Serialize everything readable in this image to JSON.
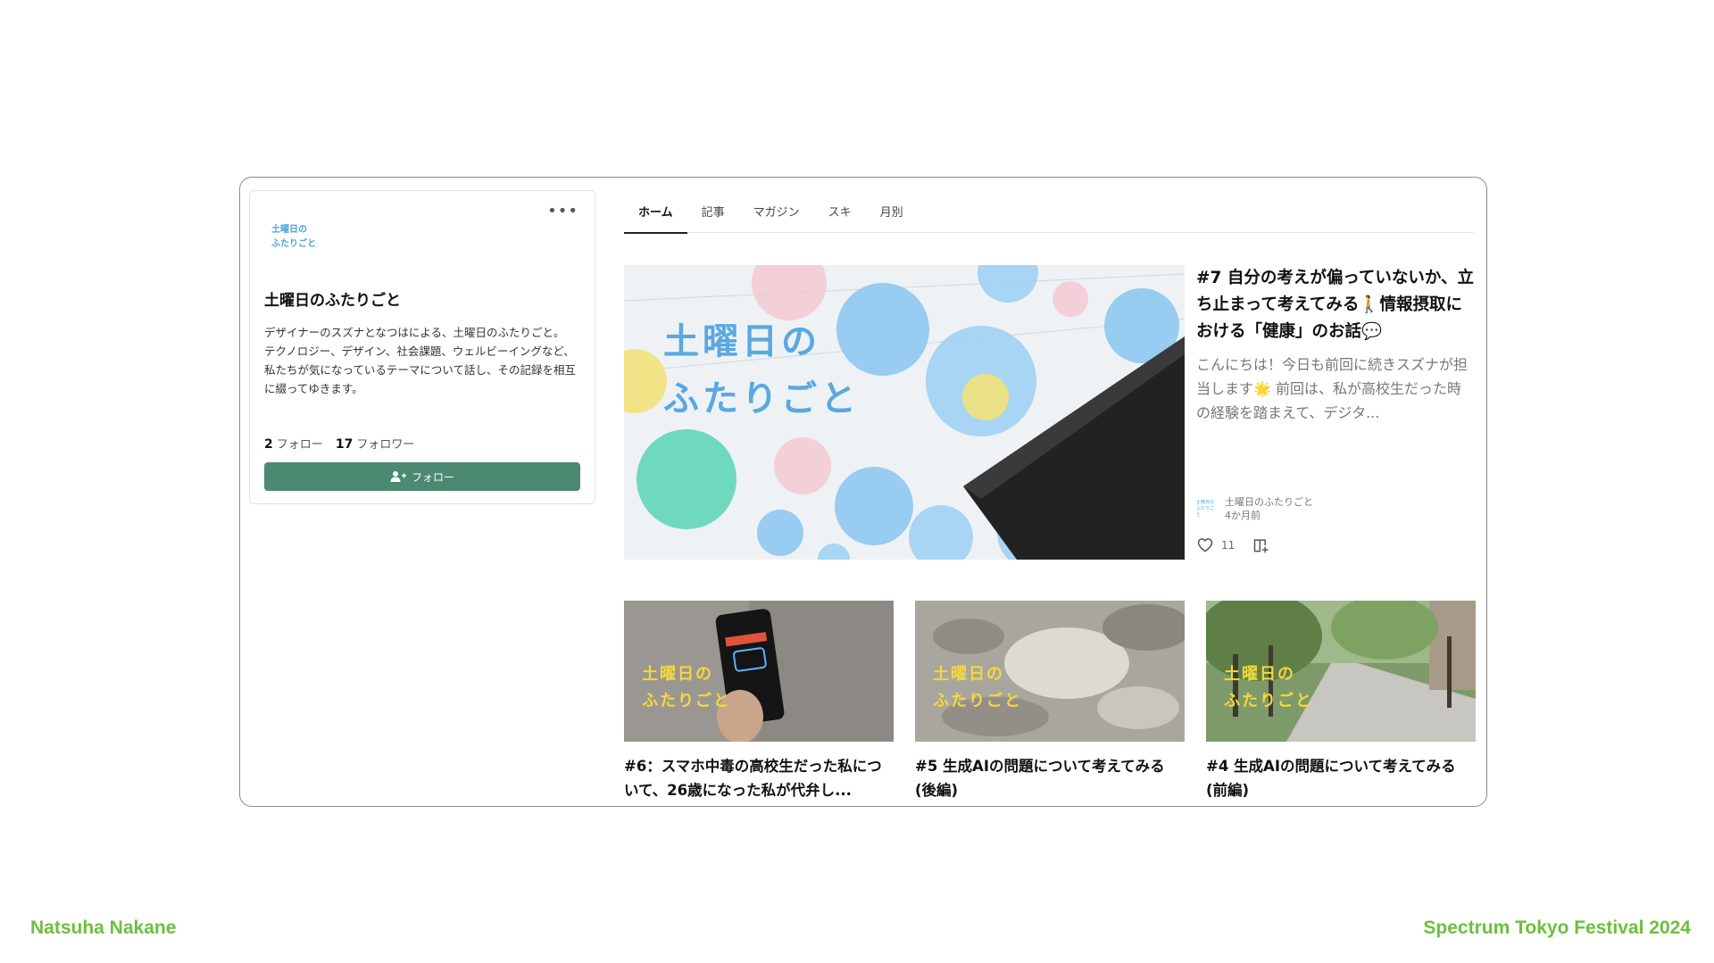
{
  "profile": {
    "logo_line1": "土曜日の",
    "logo_line2": "ふたりごと",
    "name": "土曜日のふたりごと",
    "description_line1": "デザイナーのスズナとなつはによる、土曜日のふたりごと。",
    "description_line2": "テクノロジー、デザイン、社会課題、ウェルビーイングなど、私たちが気になっているテーマについて話し、その記録を相互に綴ってゆきます。",
    "follow_count": "2",
    "follow_label": "フォロー",
    "follower_count": "17",
    "follower_label": "フォロワー",
    "follow_button": "フォロー",
    "more_icon": "more-horizontal-icon"
  },
  "tabs": [
    {
      "label": "ホーム",
      "active": true
    },
    {
      "label": "記事",
      "active": false
    },
    {
      "label": "マガジン",
      "active": false
    },
    {
      "label": "スキ",
      "active": false
    },
    {
      "label": "月別",
      "active": false
    }
  ],
  "featured": {
    "image_text_line1": "土曜日の",
    "image_text_line2": "ふたりごと",
    "title": "#7 自分の考えが偏っていないか、立ち止まって考えてみる🚶情報摂取における「健康」のお話💬",
    "excerpt": "こんにちは！今日も前回に続きスズナが担当します🌟 前回は、私が高校生だった時の経験を踏まえて、デジタ...",
    "author": "土曜日のふたりごと",
    "time": "4か月前",
    "likes": "11"
  },
  "articles": [
    {
      "thumb_line1": "土曜日の",
      "thumb_line2": "ふたりごと",
      "title": "#6：スマホ中毒の高校生だった私について、26歳になった私が代弁し..."
    },
    {
      "thumb_line1": "土曜日の",
      "thumb_line2": "ふたりごと",
      "title": "#5 生成AIの問題について考えてみる(後編)"
    },
    {
      "thumb_line1": "土曜日の",
      "thumb_line2": "ふたりごと",
      "title": "#4 生成AIの問題について考えてみる(前編)"
    }
  ],
  "footer": {
    "left": "Natsuha Nakane",
    "right": "Spectrum Tokyo Festival 2024"
  },
  "colors": {
    "accent": "#4b8a71",
    "footer": "#6cbf3f",
    "logo": "#4aa3df",
    "thumb_text": "#f3d93a"
  }
}
